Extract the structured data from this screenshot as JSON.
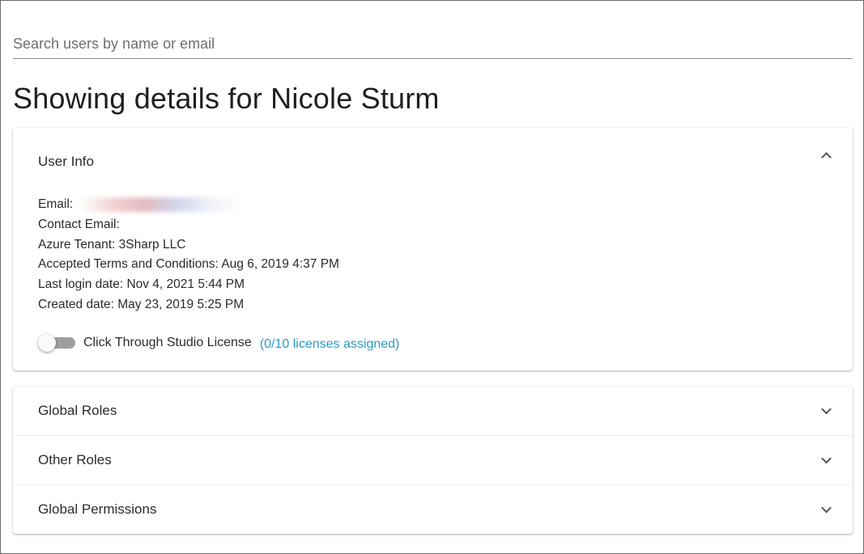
{
  "search": {
    "placeholder": "Search users by name or email",
    "value": ""
  },
  "page": {
    "title": "Showing details for Nicole Sturm"
  },
  "user_info": {
    "header": "User Info",
    "expanded": true,
    "fields": {
      "email": "Email:",
      "contact_email": "Contact Email:",
      "azure_tenant": "Azure Tenant: 3Sharp LLC",
      "accepted_terms": "Accepted Terms and Conditions: Aug 6, 2019 4:37 PM",
      "last_login": "Last login date: Nov 4, 2021 5:44 PM",
      "created": "Created date: May 23, 2019 5:25 PM"
    },
    "license": {
      "label": "Click Through Studio License",
      "assigned": "(0/10 licenses assigned)",
      "enabled": false
    }
  },
  "sections": {
    "global_roles": "Global Roles",
    "other_roles": "Other Roles",
    "global_permissions": "Global Permissions"
  },
  "icons": {
    "expanded": "chevron-up-icon",
    "collapsed": "chevron-down-icon"
  },
  "colors": {
    "link": "#2a9bc7",
    "toggle_track_off": "#9e9e9e",
    "border": "#6e6e6e"
  }
}
